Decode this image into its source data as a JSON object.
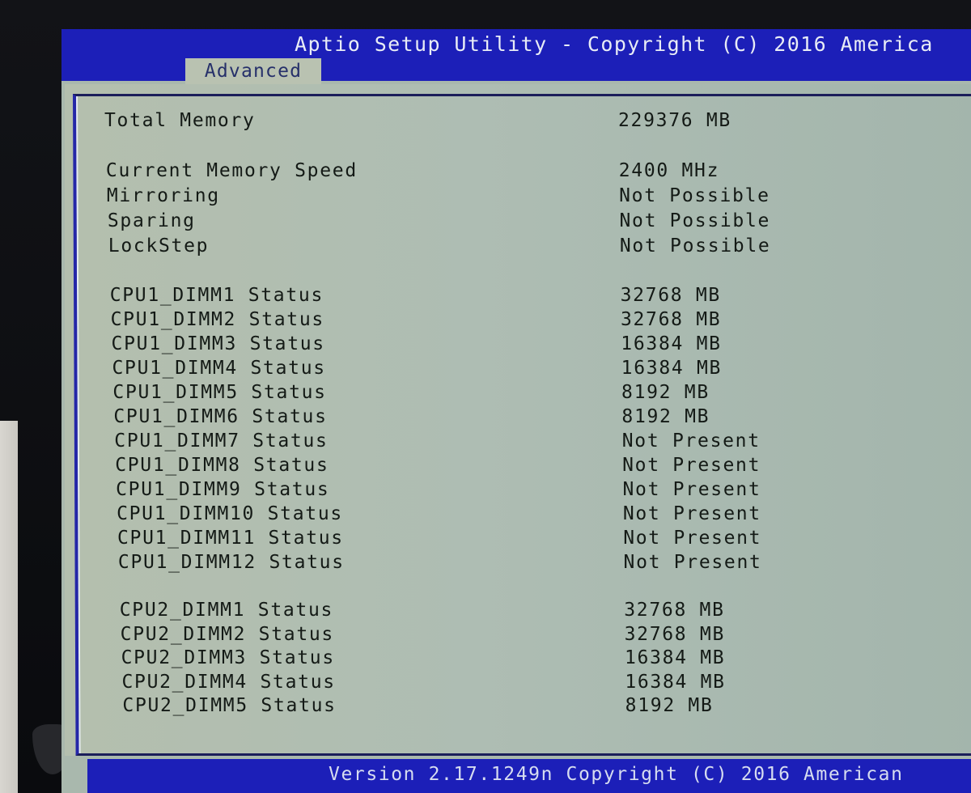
{
  "header": {
    "title": "Aptio Setup Utility - Copyright (C) 2016 America",
    "active_tab": "Advanced"
  },
  "summary": [
    {
      "label": "Total Memory",
      "value": "229376 MB"
    },
    {
      "label": "Current Memory Speed",
      "value": "2400 MHz"
    },
    {
      "label": "Mirroring",
      "value": "Not Possible"
    },
    {
      "label": "Sparing",
      "value": "Not Possible"
    },
    {
      "label": "LockStep",
      "value": "Not Possible"
    }
  ],
  "cpu1_dimms": [
    {
      "label": "CPU1_DIMM1 Status",
      "value": "32768 MB"
    },
    {
      "label": "CPU1_DIMM2 Status",
      "value": "32768 MB"
    },
    {
      "label": "CPU1_DIMM3 Status",
      "value": "16384 MB"
    },
    {
      "label": "CPU1_DIMM4 Status",
      "value": "16384 MB"
    },
    {
      "label": "CPU1_DIMM5 Status",
      "value": "8192 MB"
    },
    {
      "label": "CPU1_DIMM6 Status",
      "value": "8192 MB"
    },
    {
      "label": "CPU1_DIMM7 Status",
      "value": "Not Present"
    },
    {
      "label": "CPU1_DIMM8 Status",
      "value": "Not Present"
    },
    {
      "label": "CPU1_DIMM9 Status",
      "value": "Not Present"
    },
    {
      "label": "CPU1_DIMM10 Status",
      "value": "Not Present"
    },
    {
      "label": "CPU1_DIMM11 Status",
      "value": "Not Present"
    },
    {
      "label": "CPU1_DIMM12 Status",
      "value": "Not Present"
    }
  ],
  "cpu2_dimms": [
    {
      "label": "CPU2_DIMM1 Status",
      "value": "32768 MB"
    },
    {
      "label": "CPU2_DIMM2 Status",
      "value": "32768 MB"
    },
    {
      "label": "CPU2_DIMM3 Status",
      "value": "16384 MB"
    },
    {
      "label": "CPU2_DIMM4 Status",
      "value": "16384 MB"
    },
    {
      "label": "CPU2_DIMM5 Status",
      "value": "8192 MB"
    }
  ],
  "footer": {
    "version_text": "Version 2.17.1249n Copyright (C) 2016 American"
  },
  "colors": {
    "title_bar": "#1c1fb8",
    "panel_bg": "#aebdb3",
    "text": "#141a16",
    "title_text": "#e8ecf6"
  }
}
